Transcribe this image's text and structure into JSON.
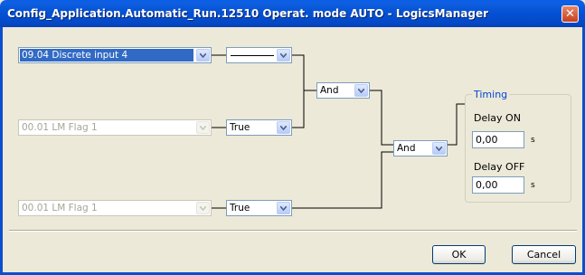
{
  "window": {
    "title": "Config_Application.Automatic_Run.12510 Operat. mode AUTO - LogicsManager",
    "close_glyph": "✕"
  },
  "inputs": [
    {
      "value": "09.04 Discrete input 4",
      "enabled": true,
      "selected": true
    },
    {
      "value": "00.01 LM Flag 1",
      "enabled": false,
      "selected": false
    },
    {
      "value": "00.01 LM Flag 1",
      "enabled": false,
      "selected": false
    }
  ],
  "signs": [
    {
      "value": "line"
    },
    {
      "value": "True"
    },
    {
      "value": "True"
    }
  ],
  "operators": [
    {
      "value": "And"
    },
    {
      "value": "And"
    }
  ],
  "timing": {
    "title": "Timing",
    "delay_on_label": "Delay ON",
    "delay_on_value": "0,00",
    "delay_on_unit": "s",
    "delay_off_label": "Delay OFF",
    "delay_off_value": "0,00",
    "delay_off_unit": "s"
  },
  "buttons": {
    "ok": "OK",
    "cancel": "Cancel"
  },
  "colors": {
    "title_bar": "#0451d4",
    "selection": "#316ac5",
    "group_title": "#0046d5",
    "dialog_bg": "#ece9d8"
  }
}
